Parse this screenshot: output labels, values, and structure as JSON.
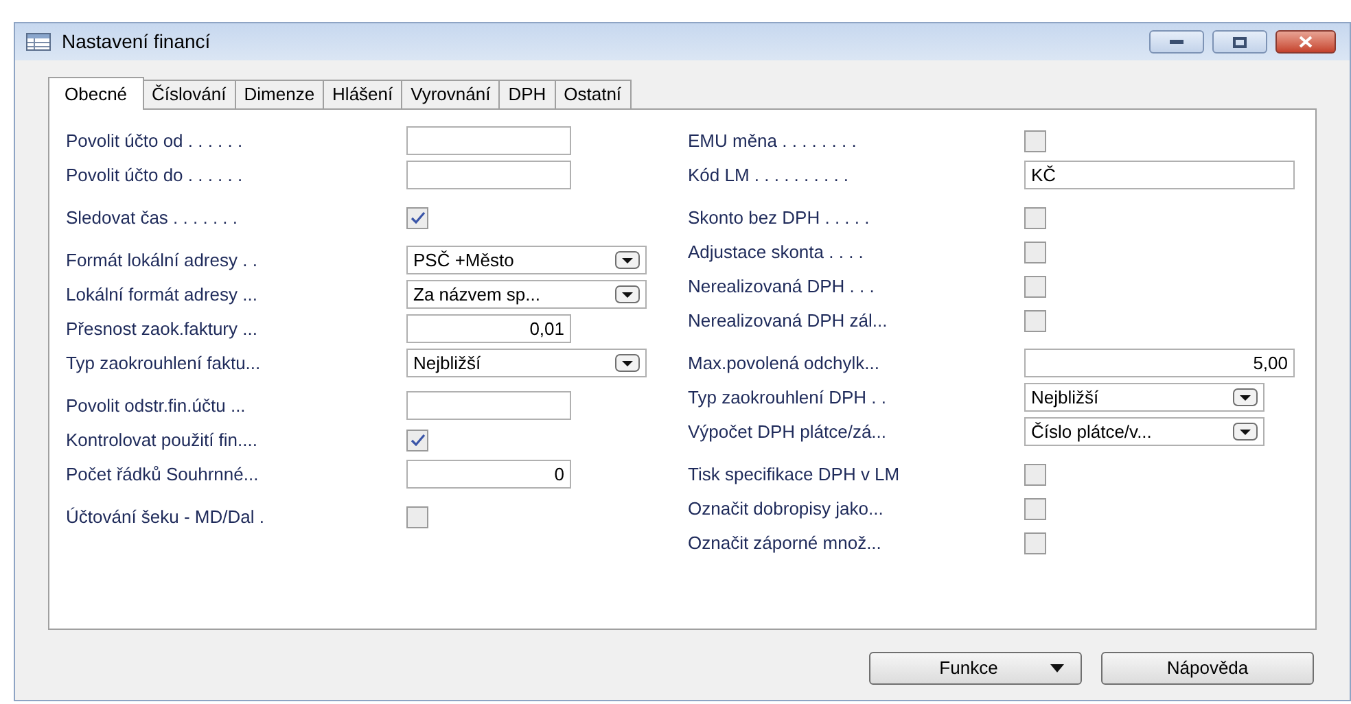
{
  "window": {
    "title": "Nastavení financí"
  },
  "tabs": [
    {
      "label": "Obecné",
      "selected": true
    },
    {
      "label": "Číslování",
      "selected": false
    },
    {
      "label": "Dimenze",
      "selected": false
    },
    {
      "label": "Hlášení",
      "selected": false
    },
    {
      "label": "Vyrovnání",
      "selected": false
    },
    {
      "label": "DPH",
      "selected": false
    },
    {
      "label": "Ostatní",
      "selected": false
    }
  ],
  "left_groups": [
    [
      {
        "kind": "text",
        "label": "Povolit účto od . . . . . ."
      },
      {
        "kind": "text",
        "label": "Povolit účto do . . . . . ."
      }
    ],
    [
      {
        "kind": "check",
        "label": "Sledovat čas . . . . . . .",
        "checked": true
      }
    ],
    [
      {
        "kind": "select",
        "label": "Formát lokální adresy . .",
        "value": "PSČ +Město"
      },
      {
        "kind": "select",
        "label": "Lokální formát adresy ...",
        "value": "Za názvem sp..."
      },
      {
        "kind": "number",
        "label": "Přesnost zaok.faktury ...",
        "value": "0,01"
      },
      {
        "kind": "select",
        "label": "Typ zaokrouhlení faktu...",
        "value": "Nejbližší"
      }
    ],
    [
      {
        "kind": "text",
        "label": "Povolit odstr.fin.účtu ..."
      },
      {
        "kind": "check",
        "label": "Kontrolovat použití fin....",
        "checked": true
      },
      {
        "kind": "number",
        "label": "Počet řádků Souhrnné...",
        "value": "0"
      }
    ],
    [
      {
        "kind": "check",
        "label": "Účtování šeku - MD/Dal  .",
        "checked": false
      }
    ]
  ],
  "right_groups": [
    [
      {
        "kind": "check",
        "label": "EMU měna . . . . . . . .",
        "checked": false
      },
      {
        "kind": "text",
        "label": "Kód LM . . . . . . . . . .",
        "value": "KČ"
      }
    ],
    [
      {
        "kind": "check",
        "label": "Skonto bez DPH . . . . .",
        "checked": false
      },
      {
        "kind": "check",
        "label": "Adjustace skonta . . . .",
        "checked": false
      },
      {
        "kind": "check",
        "label": "Nerealizovaná DPH . . .",
        "checked": false
      },
      {
        "kind": "check",
        "label": "Nerealizovaná DPH zál...",
        "checked": false
      }
    ],
    [
      {
        "kind": "number",
        "label": "Max.povolená odchylk...",
        "value": "5,00"
      },
      {
        "kind": "select",
        "label": "Typ zaokrouhlení DPH . .",
        "value": "Nejbližší"
      },
      {
        "kind": "select",
        "label": "Výpočet DPH plátce/zá...",
        "value": "Číslo plátce/v..."
      }
    ],
    [
      {
        "kind": "check",
        "label": "Tisk specifikace DPH v LM",
        "checked": false
      },
      {
        "kind": "check",
        "label": "Označit dobropisy jako...",
        "checked": false
      },
      {
        "kind": "check",
        "label": "Označit záporné množ...",
        "checked": false
      }
    ]
  ],
  "buttons": [
    {
      "label": "Funkce",
      "menu": true
    },
    {
      "label": "Nápověda",
      "menu": false
    }
  ]
}
